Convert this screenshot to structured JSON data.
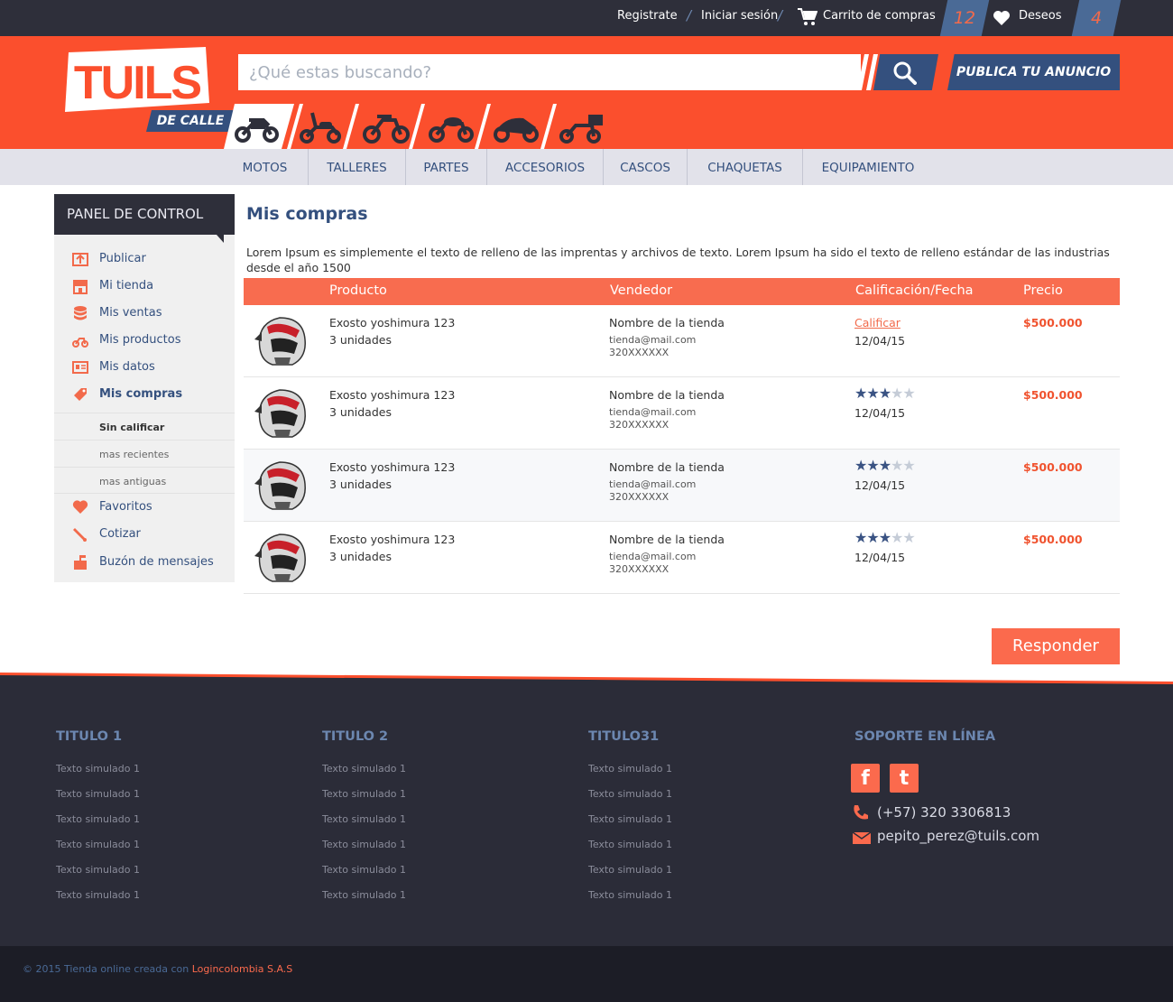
{
  "topbar": {
    "register": "Registrate",
    "login": "Iniciar sesión",
    "cart": "Carrito de compras",
    "cart_count": "12",
    "wishes": "Deseos",
    "wishes_count": "4",
    "separator": "/"
  },
  "header": {
    "logo_text": "TUILS",
    "logo_sub": "DE CALLE",
    "search_placeholder": "¿Qué estas buscando?",
    "publish_label": "PUBLICA TU ANUNCIO",
    "categories": [
      "sport-bike-icon",
      "scooter-icon",
      "dirt-bike-icon",
      "cruiser-icon",
      "superbike-icon",
      "touring-bike-icon"
    ]
  },
  "nav": {
    "items": [
      "MOTOS",
      "TALLERES",
      "PARTES",
      "ACCESORIOS",
      "CASCOS",
      "CHAQUETAS",
      "EQUIPAMIENTO"
    ]
  },
  "sidebar": {
    "title": "PANEL DE CONTROL",
    "items": [
      "Publicar",
      "Mi tienda",
      "Mis ventas",
      "Mis productos",
      "Mis datos",
      "Mis compras"
    ],
    "subitems": [
      "Sin calificar",
      "mas recientes",
      "mas antiguas"
    ],
    "items2": [
      "Favoritos",
      "Cotizar",
      "Buzón de mensajes"
    ]
  },
  "main": {
    "title": "Mis compras",
    "description": "Lorem Ipsum es simplemente el texto de relleno de las imprentas y archivos de texto. Lorem Ipsum ha sido el texto de relleno estándar de las industrias desde el año 1500",
    "columns": [
      "Producto",
      "Vendedor",
      "Calificación/Fecha",
      "Precio"
    ],
    "rows": [
      {
        "product": "Exosto yoshimura 123",
        "qty": "3 unidades",
        "store": "Nombre de la tienda",
        "email": "tienda@mail.com",
        "phone": "320XXXXXX",
        "rate_label": "Calificar",
        "stars": 0,
        "date": "12/04/15",
        "price": "$500.000"
      },
      {
        "product": "Exosto yoshimura 123",
        "qty": "3 unidades",
        "store": "Nombre de la tienda",
        "email": "tienda@mail.com",
        "phone": "320XXXXXX",
        "rate_label": "",
        "stars": 3,
        "date": "12/04/15",
        "price": "$500.000"
      },
      {
        "product": "Exosto yoshimura 123",
        "qty": "3 unidades",
        "store": "Nombre de la tienda",
        "email": "tienda@mail.com",
        "phone": "320XXXXXX",
        "rate_label": "",
        "stars": 3,
        "date": "12/04/15",
        "price": "$500.000"
      },
      {
        "product": "Exosto yoshimura 123",
        "qty": "3 unidades",
        "store": "Nombre de la tienda",
        "email": "tienda@mail.com",
        "phone": "320XXXXXX",
        "rate_label": "",
        "stars": 3,
        "date": "12/04/15",
        "price": "$500.000"
      }
    ],
    "respond_label": "Responder"
  },
  "footer": {
    "col1_title": "TITULO 1",
    "col2_title": "TITULO 2",
    "col3_title": "TITULO31",
    "col4_title": "SOPORTE EN LÍNEA",
    "link_text": "Texto simulado 1",
    "phone": "(57) 320 3306813",
    "phone_display": "(+57) 320 3306813",
    "email": "pepito_perez@tuils.com",
    "copyright": "© 2015 Tienda online creada con ",
    "company": "Logincolombia S.A.S"
  },
  "colors": {
    "accent": "#fb4f2d",
    "brand_blue": "#34507e",
    "dark": "#2e2f3a"
  }
}
